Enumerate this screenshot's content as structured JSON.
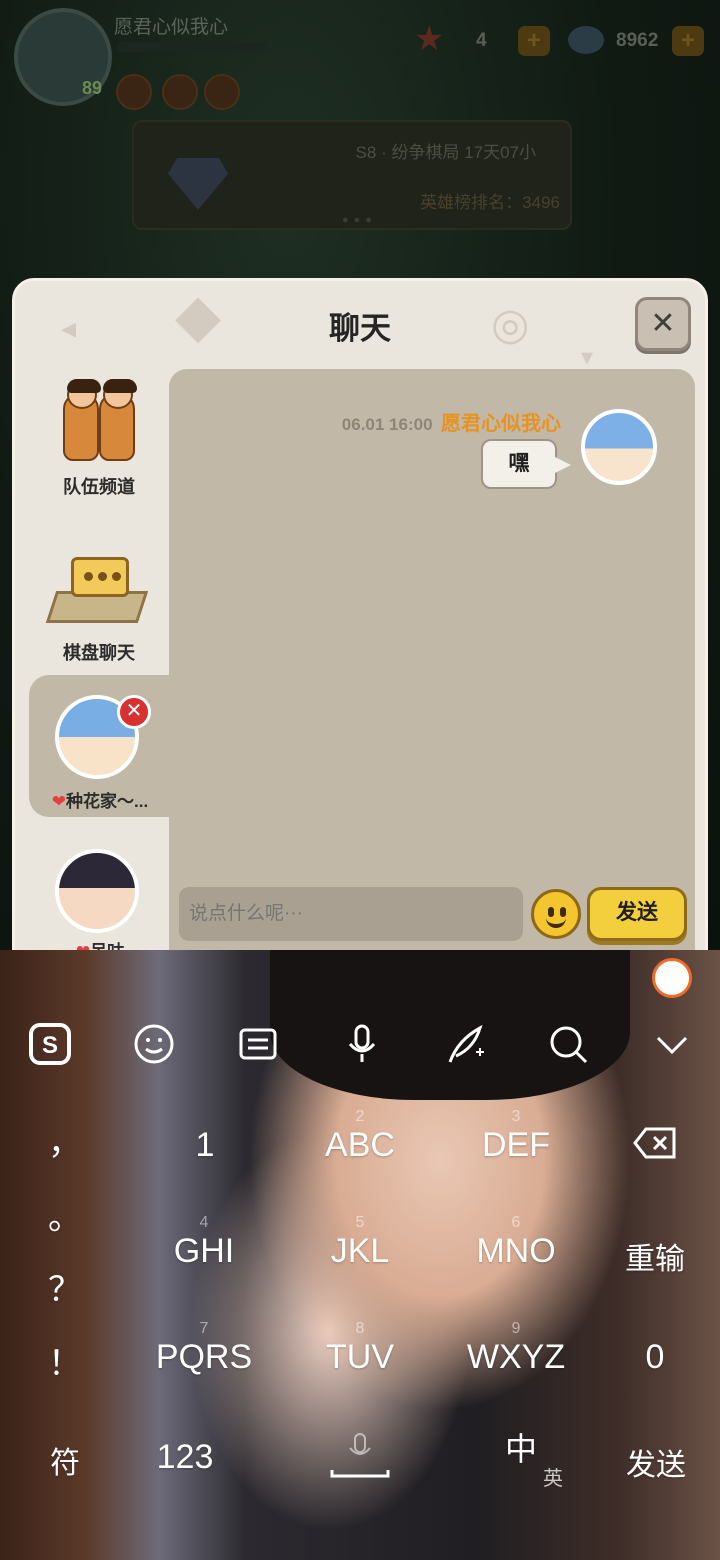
{
  "game_hud": {
    "player_name": "愿君心似我心",
    "level": "89",
    "stars": "4",
    "gems": "8962",
    "plus": "+",
    "season": "S8 · 纷争棋局 17天07小",
    "rank": "英雄榜排名：3496"
  },
  "chat": {
    "title": "聊天",
    "close_label": "✕",
    "sidebar": {
      "team_label": "队伍频道",
      "board_label": "棋盘聊天",
      "contact1_name": "种花家～...",
      "contact2_name": "呆咕",
      "remove_label": "✕",
      "heart": "❤"
    },
    "message": {
      "time": "06.01 16:00",
      "sender": "愿君心似我心",
      "text": "嘿"
    },
    "input_placeholder": "说点什么呢···",
    "send_label": "发送"
  },
  "keyboard": {
    "toolbar_icons": [
      "sogou-logo-icon",
      "emoji-icon",
      "clipboard-icon",
      "microphone-icon",
      "handwriting-icon",
      "search-icon",
      "collapse-chevron-icon"
    ],
    "punctuation": [
      "，",
      "。",
      "？",
      "！"
    ],
    "keys": {
      "k1": "1",
      "abc": "ABC",
      "abc_num": "2",
      "def": "DEF",
      "def_num": "3",
      "ghi": "GHI",
      "ghi_num": "4",
      "jkl": "JKL",
      "jkl_num": "5",
      "mno": "MNO",
      "mno_num": "6",
      "pqrs": "PQRS",
      "pqrs_num": "7",
      "tuv": "TUV",
      "tuv_num": "8",
      "wxyz": "WXYZ",
      "wxyz_num": "9",
      "retype": "重输",
      "zero": "0",
      "symbols": "符",
      "num123": "123",
      "lang_main": "中",
      "lang_alt": "英",
      "send": "发送",
      "backspace": "⌫"
    }
  }
}
